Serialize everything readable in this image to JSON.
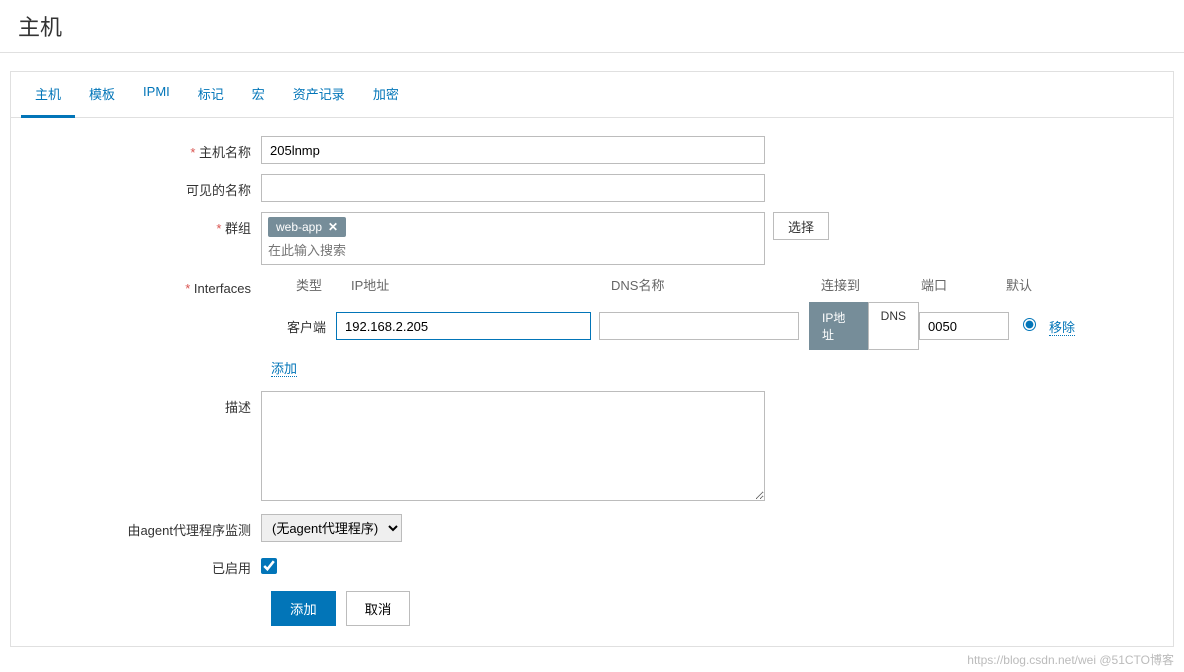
{
  "page_title": "主机",
  "tabs": [
    "主机",
    "模板",
    "IPMI",
    "标记",
    "宏",
    "资产记录",
    "加密"
  ],
  "active_tab_index": 0,
  "form": {
    "host_name_label": "主机名称",
    "host_name_value": "205lnmp",
    "visible_name_label": "可见的名称",
    "visible_name_value": "",
    "groups_label": "群组",
    "group_tag": "web-app",
    "group_search_placeholder": "在此输入搜索",
    "select_button": "选择",
    "interfaces_label": "Interfaces",
    "interface_headers": {
      "type": "类型",
      "ip": "IP地址",
      "dns": "DNS名称",
      "connect_to": "连接到",
      "port": "端口",
      "default": "默认"
    },
    "interface_row": {
      "type_label": "客户端",
      "ip_value": "192.168.2.205",
      "dns_value": "",
      "connect_ip": "IP地址",
      "connect_dns": "DNS",
      "port_value": "0050",
      "remove_label": "移除"
    },
    "add_link": "添加",
    "description_label": "描述",
    "description_value": "",
    "agent_label": "由agent代理程序监测",
    "agent_select": "(无agent代理程序)",
    "enabled_label": "已启用",
    "enabled_checked": true,
    "submit_button": "添加",
    "cancel_button": "取消"
  },
  "watermark": "https://blog.csdn.net/wei @51CTO博客"
}
